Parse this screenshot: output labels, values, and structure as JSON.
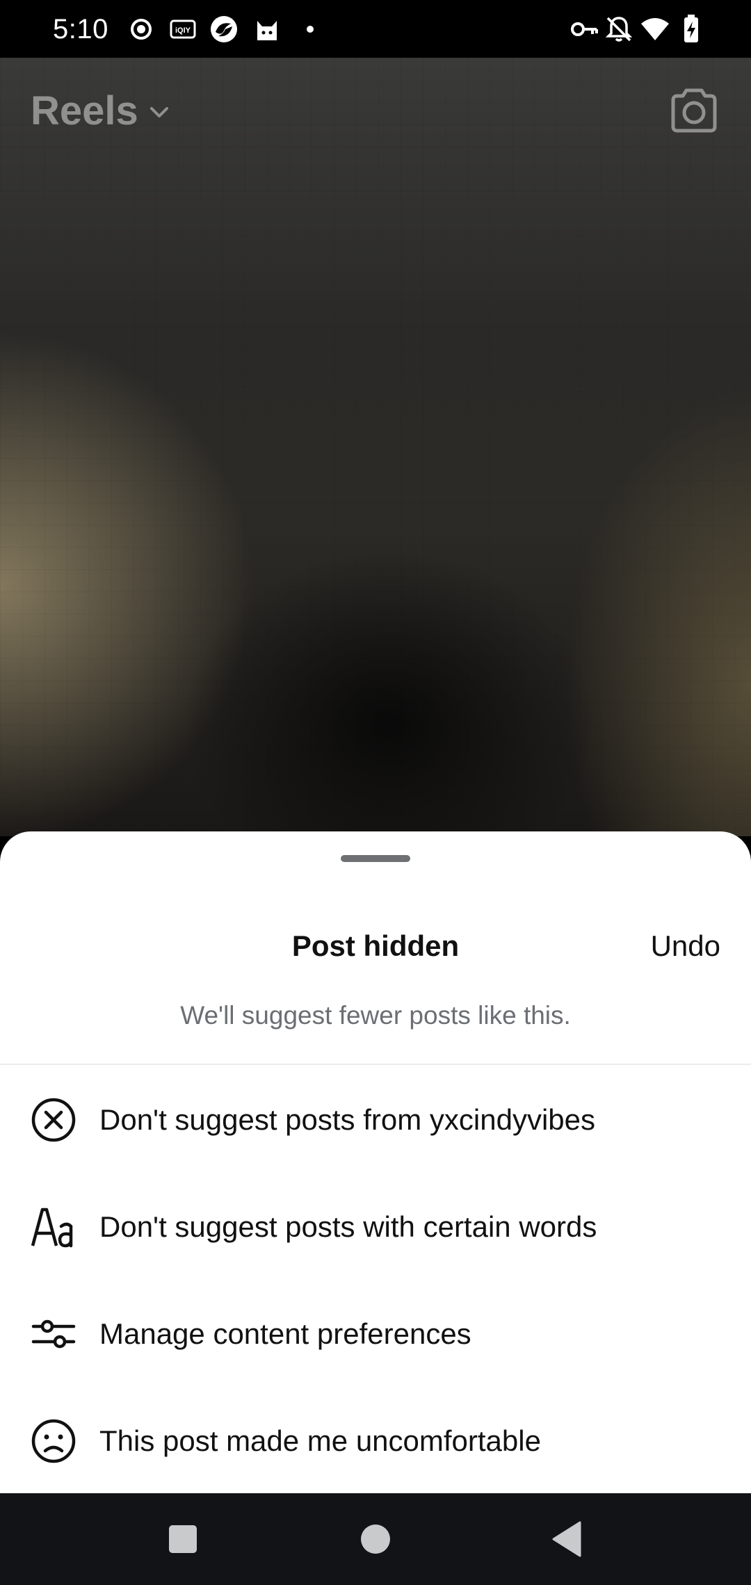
{
  "status_bar": {
    "time": "5:10",
    "left_icons": [
      "record-icon",
      "iqiyi-icon",
      "app-swirl-icon",
      "cat-app-icon",
      "dot-icon"
    ],
    "right_icons": [
      "vpn-key-icon",
      "notifications-off-icon",
      "wifi-icon",
      "battery-charging-icon"
    ]
  },
  "header": {
    "title": "Reels",
    "dropdown_icon": "chevron-down-icon",
    "camera_icon": "camera-icon"
  },
  "sheet": {
    "title": "Post hidden",
    "undo_label": "Undo",
    "subtitle": "We'll suggest fewer posts like this.",
    "options": [
      {
        "icon": "close-circle-icon",
        "label": "Don't suggest posts from yxcindyvibes"
      },
      {
        "icon": "text-aa-icon",
        "label": "Don't suggest posts with certain words"
      },
      {
        "icon": "sliders-icon",
        "label": "Manage content preferences"
      },
      {
        "icon": "sad-face-icon",
        "label": "This post made me uncomfortable"
      }
    ]
  },
  "nav_bar": {
    "buttons": [
      "recents-square-icon",
      "home-circle-icon",
      "back-triangle-icon"
    ]
  },
  "colors": {
    "sheet_background": "#ffffff",
    "title_text": "#111111",
    "subtitle_text": "#6b6e73",
    "nav_background": "#111317"
  }
}
